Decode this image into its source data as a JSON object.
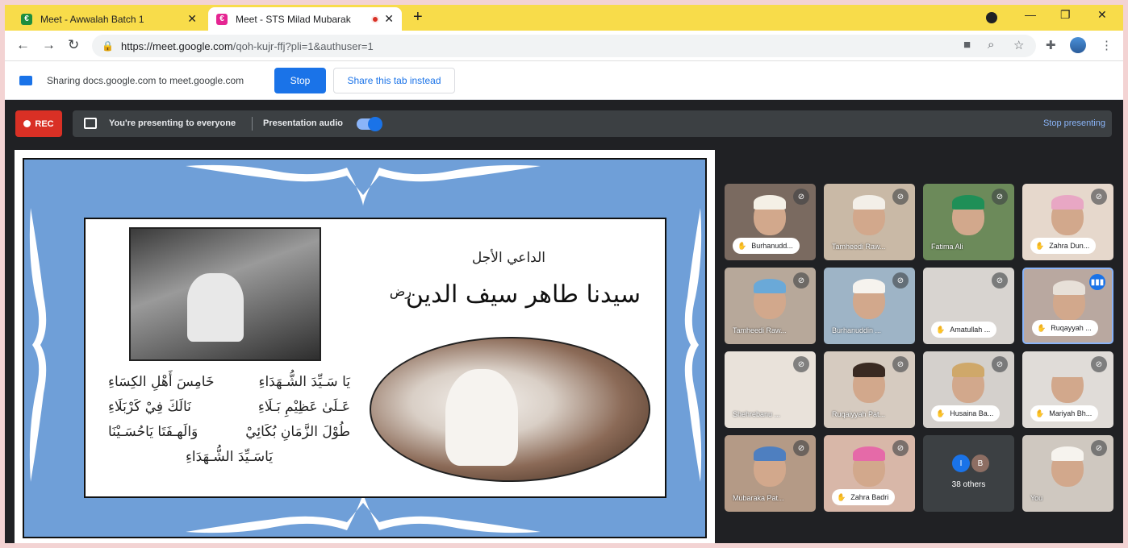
{
  "browser": {
    "tabs": [
      {
        "title": "Meet - Awwalah Batch 1",
        "favicon_color": "#1e8e3e"
      },
      {
        "title": "Meet - STS Milad Mubarak",
        "favicon_color": "#e52592",
        "recording": true
      }
    ],
    "url_host": "https://meet.google.com",
    "url_path": "/qoh-kujr-ffj?pli=1&authuser=1"
  },
  "share_bar": {
    "text": "Sharing docs.google.com to meet.google.com",
    "stop_label": "Stop",
    "share_tab_label": "Share this tab instead"
  },
  "meet_controls": {
    "rec_label": "REC",
    "presenting_text": "You're presenting to everyone",
    "audio_label": "Presentation audio",
    "audio_enabled": true,
    "stop_presenting_label": "Stop presenting"
  },
  "slide": {
    "title_small": "الداعي الأجل",
    "title_big": "سيدنا طاهر سيف الدين",
    "title_suffix": "رض",
    "poem": [
      [
        "يَا سَـيِّدَ الشُّـهَدَاءِ",
        "خَامِسَ أَهْلِ الكِسَاءِ"
      ],
      [
        "عَـلَىٰ عَظِيْمِ بَـلَاءِ",
        "نَالَكَ فِيْ كَرْبَلَاءِ"
      ],
      [
        "طُوْلَ الزَّمَانِ بُكَائِيْ",
        "وَالَهـفَتَا يَاحُسَـيْنَا"
      ]
    ],
    "poem_last": "يَاسَـيِّدَ الشُّـهَدَاءِ"
  },
  "participants": [
    {
      "name": "Burhanudd...",
      "style": "chip",
      "bg": "#7a6a60",
      "cap": "#f4f0e6"
    },
    {
      "name": "Tamheedi Raw...",
      "style": "plain",
      "bg": "#c9b9a6",
      "cap": "#f3efe8"
    },
    {
      "name": "Fatima Ali",
      "style": "plain",
      "bg": "#6c8a5a",
      "cap": "#1f8f57"
    },
    {
      "name": "Zahra Dun...",
      "style": "chip",
      "bg": "#e6d8cc",
      "cap": "#e8a7c4"
    },
    {
      "name": "Tamheedi Raw...",
      "style": "plain",
      "bg": "#b7a89a",
      "cap": "#6aa9d8"
    },
    {
      "name": "Burhanuddin ...",
      "style": "plain",
      "bg": "#9eb4c6",
      "cap": "#f6f3ee"
    },
    {
      "name": "Amatullah ...",
      "style": "chip",
      "bg": "#d8d4d0",
      "cap": "#d8d4d0",
      "noface": true
    },
    {
      "name": "Ruqayyah ...",
      "style": "chip",
      "bg": "#b9a8a0",
      "cap": "#e7e0d8",
      "speaking": true
    },
    {
      "name": "Shehrebanu ...",
      "style": "plain",
      "bg": "#e9e2da",
      "cap": "#e9e2da",
      "noface": true
    },
    {
      "name": "Ruqaiyyah Pat...",
      "style": "plain",
      "bg": "#d6cbc0",
      "cap": "#3a2a22"
    },
    {
      "name": "Husaina Ba...",
      "style": "chip",
      "bg": "#d4d0cc",
      "cap": "#cfa86a"
    },
    {
      "name": "Mariyah Bh...",
      "style": "chip",
      "bg": "#e0dcd8",
      "cap": "#e0dcd8"
    },
    {
      "name": "Mubaraka Pat...",
      "style": "plain",
      "bg": "#b49a86",
      "cap": "#4e7fc0"
    },
    {
      "name": "Zahra Badri",
      "style": "chip",
      "bg": "#d8b7a8",
      "cap": "#e56aa8"
    },
    {
      "others": true,
      "count_label": "38 others",
      "avatars": [
        {
          "letter": "I",
          "color": "#1a73e8"
        },
        {
          "letter": "B",
          "color": "#8d6e63"
        }
      ]
    },
    {
      "name": "You",
      "style": "plain",
      "bg": "#cfc8c0",
      "cap": "#f6f3ee"
    }
  ]
}
